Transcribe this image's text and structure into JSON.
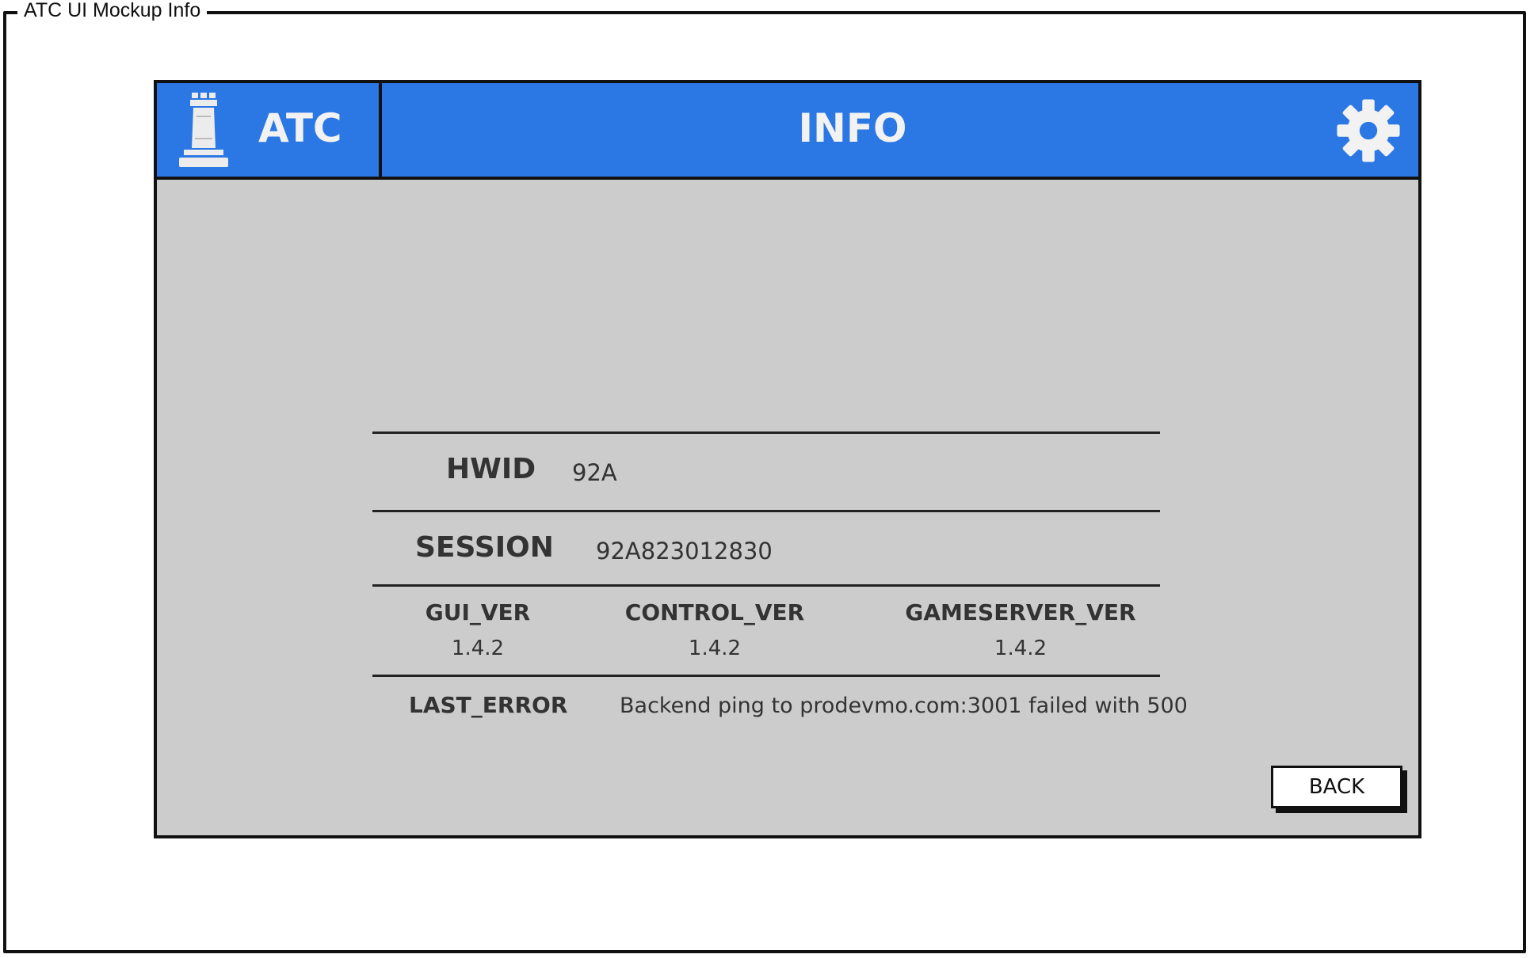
{
  "frame": {
    "title": "ATC UI Mockup Info"
  },
  "header": {
    "brand": "ATC",
    "brand_icon": "rook-chess-icon",
    "title": "INFO",
    "settings_icon": "gear-icon",
    "color": "#2b78e4"
  },
  "info": {
    "hwid": {
      "label": "HWID",
      "value": "92A"
    },
    "session": {
      "label": "SESSION",
      "value": "92A823012830"
    },
    "versions": [
      {
        "label": "GUI_VER",
        "value": "1.4.2"
      },
      {
        "label": "CONTROL_VER",
        "value": "1.4.2"
      },
      {
        "label": "GAMESERVER_VER",
        "value": "1.4.2"
      }
    ],
    "last_error": {
      "label": "LAST_ERROR",
      "value": "Backend ping to prodevmo.com:3001 failed with 500"
    }
  },
  "actions": {
    "back_label": "BACK"
  },
  "colors": {
    "header": "#2b78e4",
    "background": "#cccccc",
    "text": "#333333"
  }
}
